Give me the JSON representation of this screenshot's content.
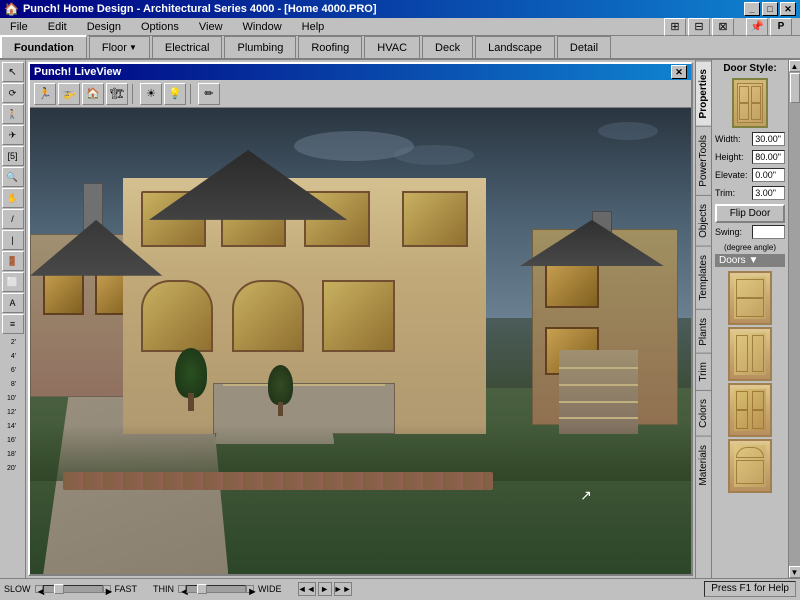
{
  "titlebar": {
    "title": "Punch! Home Design - Architectural Series 4000 - [Home 4000.PRO]",
    "minimize": "_",
    "maximize": "□",
    "close": "✕"
  },
  "menu": {
    "items": [
      "File",
      "Edit",
      "Design",
      "Options",
      "View",
      "Window",
      "Help"
    ]
  },
  "tabs": [
    {
      "label": "Foundation",
      "active": true
    },
    {
      "label": "Floor ▼",
      "active": false
    },
    {
      "label": "Electrical",
      "active": false
    },
    {
      "label": "Plumbing",
      "active": false
    },
    {
      "label": "Roofing",
      "active": false
    },
    {
      "label": "HVAC",
      "active": false
    },
    {
      "label": "Deck",
      "active": false
    },
    {
      "label": "Landscape",
      "active": false
    },
    {
      "label": "Detail",
      "active": false
    }
  ],
  "liveview": {
    "title": "Punch! LiveView",
    "close_btn": "✕"
  },
  "liveview_toolbar": {
    "tools": [
      "🏃",
      "🚁",
      "🏠",
      "🏗",
      "🌅",
      "💡",
      "✏"
    ]
  },
  "right_vtabs": [
    {
      "label": "Properties",
      "active": true
    },
    {
      "label": "PowerTools"
    },
    {
      "label": "Objects"
    },
    {
      "label": "Templates"
    },
    {
      "label": "Plants"
    },
    {
      "label": "Trim"
    },
    {
      "label": "Colors"
    },
    {
      "label": "Materials"
    }
  ],
  "door_style": {
    "label": "Door Style:",
    "width_label": "Width:",
    "width_value": "30.00\"",
    "height_label": "Height:",
    "height_value": "80.00\"",
    "elevate_label": "Elevate:",
    "elevate_value": "0.00\"",
    "trim_label": "Trim:",
    "trim_value": "3.00\"",
    "flip_door_label": "Flip Door",
    "swing_label": "Swing:",
    "swing_sub": "(degree angle)"
  },
  "doors_section": {
    "label": "Doors ▼"
  },
  "ruler_marks": [
    "2'",
    "4'",
    "6'",
    "8'",
    "10'",
    "12'",
    "14'",
    "16'",
    "18'",
    "20'"
  ],
  "status_bar": {
    "help_text": "Press F1 for Help",
    "speed_label_slow": "SLOW",
    "speed_label_fast": "FAST",
    "thin_label": "THIN",
    "wide_label": "WIDE"
  }
}
